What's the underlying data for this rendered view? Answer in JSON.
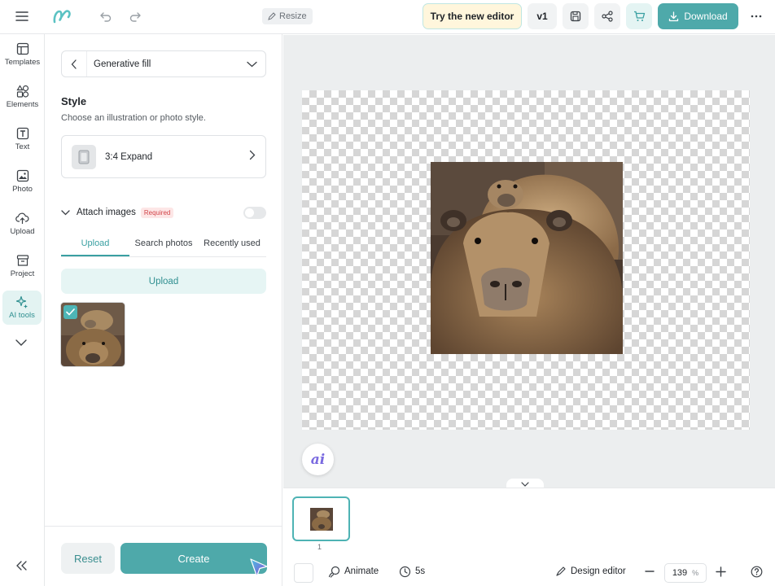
{
  "topbar": {
    "resize_label": "Resize",
    "try_label": "Try the new editor",
    "version_label": "v1",
    "download_label": "Download",
    "icons": [
      "menu-icon",
      "logo-icon",
      "undo-icon",
      "redo-icon",
      "save-icon",
      "share-icon",
      "cart-icon",
      "more-icon"
    ]
  },
  "rail": {
    "items": [
      {
        "label": "Templates",
        "icon": "templates-icon"
      },
      {
        "label": "Elements",
        "icon": "elements-icon"
      },
      {
        "label": "Text",
        "icon": "text-icon"
      },
      {
        "label": "Photo",
        "icon": "photo-icon"
      },
      {
        "label": "Upload",
        "icon": "upload-icon"
      },
      {
        "label": "Project",
        "icon": "project-icon"
      },
      {
        "label": "AI tools",
        "icon": "ai-tools-icon",
        "active": true
      }
    ]
  },
  "panel": {
    "dropdown_label": "Generative fill",
    "style_title": "Style",
    "style_subtitle": "Choose an illustration or photo style.",
    "style_option": "3:4 Expand",
    "attach_label": "Attach images",
    "required_badge": "Required",
    "attach_enabled": false,
    "tabs": [
      {
        "label": "Upload",
        "active": true
      },
      {
        "label": "Search photos",
        "active": false
      },
      {
        "label": "Recently used",
        "active": false
      }
    ],
    "upload_button": "Upload",
    "thumbnail_selected": true,
    "reset_label": "Reset",
    "create_label": "Create"
  },
  "canvas": {
    "ai_label": "ai"
  },
  "pages": {
    "page_number": "1"
  },
  "bottombar": {
    "animate_label": "Animate",
    "duration_label": "5s",
    "design_editor_label": "Design editor",
    "zoom_value": "139",
    "zoom_unit": "%"
  },
  "colors": {
    "accent": "#4ea9aa",
    "accent_light": "#e6f5f4",
    "required_text": "#d2454a",
    "ai_purple": "#7a6ae0"
  }
}
